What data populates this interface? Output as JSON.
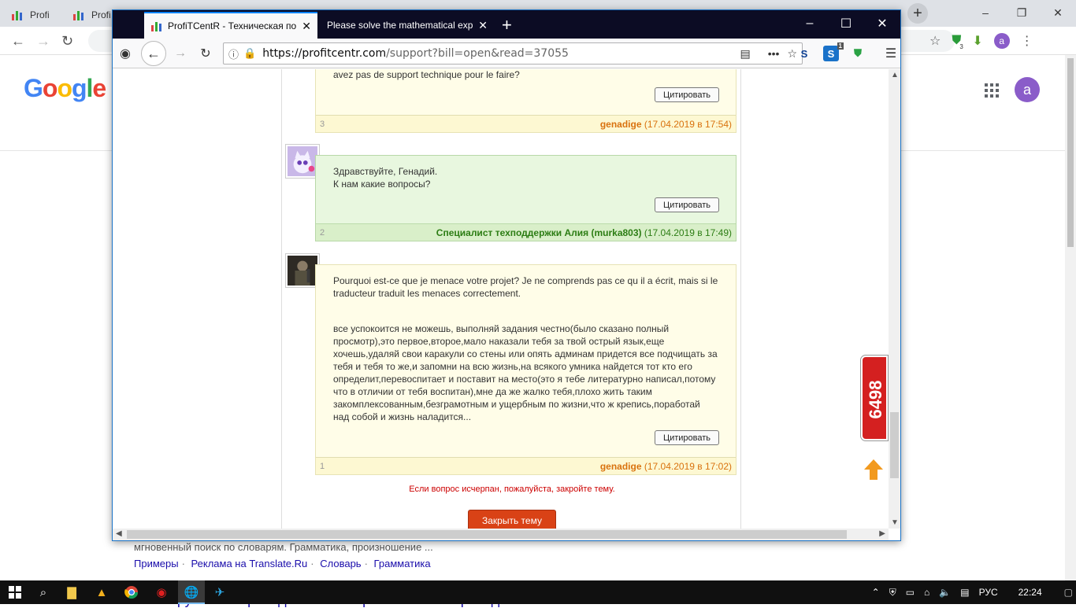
{
  "chrome": {
    "tabs": [
      {
        "title": "Profi"
      },
      {
        "title": "Profi"
      }
    ],
    "profile_initial": "a",
    "ext_badge": "3"
  },
  "google": {
    "logo": "Google",
    "avatar_initial": "a",
    "result_snippet": "мгновенный поиск по словарям. Грамматика, произношение ...",
    "result_links": [
      "Примеры",
      "Реклама на Translate.Ru",
      "Словарь",
      "Грамматика"
    ],
    "result_title_partial": "Англо-русский переводчик – словарь и онлайн перевод на английский"
  },
  "firefox": {
    "tab1_title": "ProfiTCentR - Техническая по",
    "tab2_title": "Please solve the mathematical expr",
    "url_host": "https://profitcentr.com",
    "url_path": "/support?bill=open&read=37055",
    "ext_badge": "1"
  },
  "thread": {
    "messages": [
      {
        "num": "3",
        "author": "genadige",
        "date": "(17.04.2019 в 17:54)",
        "text": "avez pas de support technique pour le faire?",
        "style": "user"
      },
      {
        "num": "2",
        "author": "Специалист техподдержки Алия (murka803)",
        "date": "(17.04.2019 в 17:49)",
        "line1": "Здравствуйте, Генадий.",
        "line2": "К нам какие вопросы?",
        "style": "staff"
      },
      {
        "num": "1",
        "author": "genadige",
        "date": "(17.04.2019 в 17:02)",
        "para1": "Pourquoi est-ce que je menace votre projet? Je ne comprends pas ce qu il a écrit, mais si le traducteur traduit les menaces correctement.",
        "para2": "все успокоится не можешь, выполняй задания честно(было сказано полный просмотр),это первое,второе,мало наказали тебя за твой острый язык,еще хочешь,удаляй свои каракули со стены или опять админам придется все подчищать за тебя и тебя то же,и запомни на всю жизнь,на всякого умника найдется тот кто его определит,перевоспитает и поставит на место(это я тебе литературно написал,потому что в отличии от тебя воспитан),мне да же жалко тебя,плохо жить таким закомплексованным,безграмотным и ущербным по жизни,что ж крепись,поработай над собой и жизнь наладится...",
        "style": "user"
      }
    ],
    "quote_label": "Цитировать",
    "close_hint": "Если вопрос исчерпан, пожалуйста, закройте тему.",
    "close_button": "Закрыть тему"
  },
  "counter": "6498",
  "taskbar": {
    "lang": "РУС",
    "time": "22:24"
  }
}
